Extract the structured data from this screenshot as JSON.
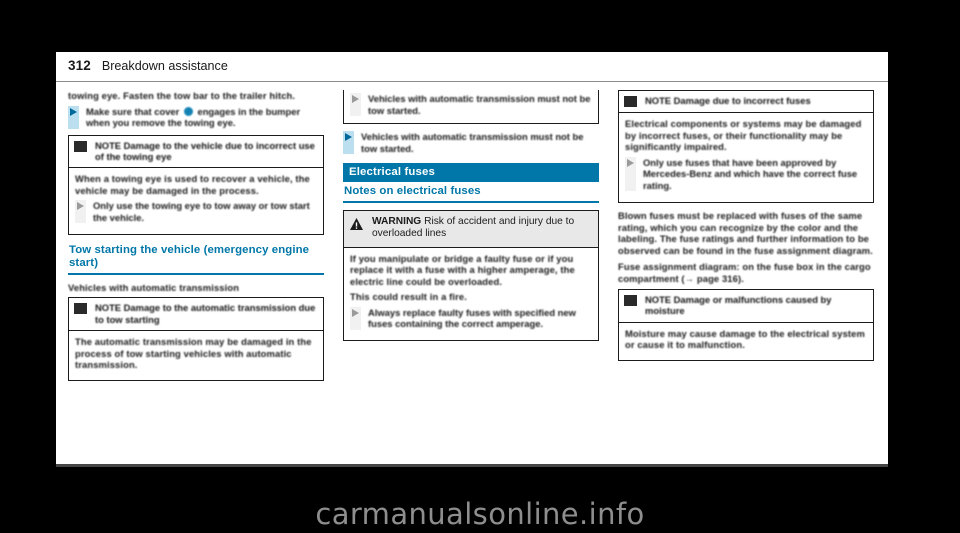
{
  "document": {
    "page_number": "312",
    "chapter": "Breakdown assistance"
  },
  "watermark": "carmanualsonline.info",
  "column_left": {
    "continued_paragraph": "towing eye. Fasten the tow bar to the trailer hitch.",
    "bullet_1": "Make sure that cover ● engages in the bumper when you remove the towing eye.",
    "note_1": {
      "icon": "note-square-icon",
      "title": "NOTE Damage to the vehicle due to incorrect use of the towing eye",
      "body": "When a towing eye is used to recover a vehicle, the vehicle may be damaged in the process.",
      "bullet": "Only use the towing eye to tow away or tow start the vehicle."
    },
    "section_heading": "Tow starting the vehicle (emergency engine start)",
    "subheading": "Vehicles with automatic transmission",
    "note_2": {
      "icon": "note-square-icon",
      "title": "NOTE Damage to the automatic transmission due to tow starting",
      "body": "The automatic transmission may be damaged in the process of tow starting vehicles with automatic transmission."
    }
  },
  "column_middle": {
    "note_continued_bullet": "Vehicles with automatic transmission must not be tow started.",
    "bullet_1": "Vehicles with automatic transmission must not be tow started.",
    "section_bar": "Electrical fuses",
    "section_sub": "Notes on electrical fuses",
    "warning": {
      "icon": "warning-triangle-icon",
      "label": "WARNING",
      "title": "Risk of accident and injury due to overloaded lines",
      "body_1": "If you manipulate or bridge a faulty fuse or if you replace it with a fuse with a higher amperage, the electric line could be overloaded.",
      "body_2": "This could result in a fire.",
      "bullet": "Always replace faulty fuses with specified new fuses containing the correct amperage."
    }
  },
  "column_right": {
    "note_1": {
      "icon": "note-square-icon",
      "title": "NOTE Damage due to incorrect fuses",
      "body": "Electrical components or systems may be damaged by incorrect fuses, or their functionality may be significantly impaired.",
      "bullet": "Only use fuses that have been approved by Mercedes-Benz and which have the correct fuse rating."
    },
    "paragraph_1": "Blown fuses must be replaced with fuses of the same rating, which you can recognize by the color and the labeling. The fuse ratings and further information to be observed can be found in the fuse assignment diagram.",
    "paragraph_2": "Fuse assignment diagram: on the fuse box in the cargo compartment (→ page 316).",
    "note_2": {
      "icon": "note-square-icon",
      "title": "NOTE Damage or malfunctions caused by moisture",
      "body": "Moisture may cause damage to the electrical system or cause it to malfunction."
    }
  },
  "colors": {
    "accent_blue": "#0077a8",
    "bullet_blue": "#00699b",
    "bullet_bg": "#bcdff0",
    "text": "#1b1b1b",
    "warning_bg": "#e8e8e8",
    "page_bg": "#ffffff",
    "backdrop": "#000000"
  }
}
